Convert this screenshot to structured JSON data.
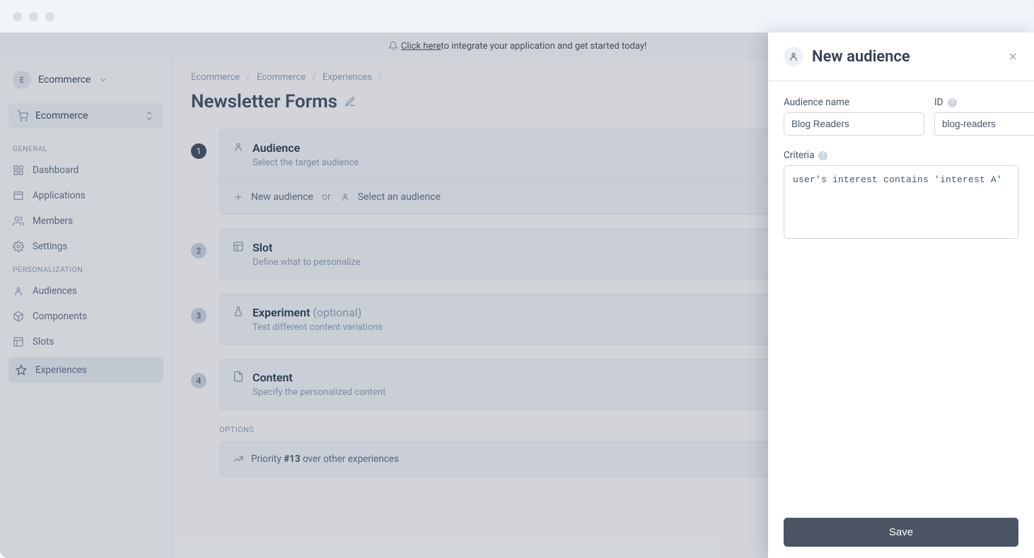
{
  "banner": {
    "link_text": "Click here",
    "rest": " to integrate your application and get started today!"
  },
  "workspace": {
    "name": "Ecommerce",
    "initial": "E"
  },
  "project": {
    "name": "Ecommerce"
  },
  "sidebar": {
    "section_general": "GENERAL",
    "section_personalization": "PERSONALIZATION",
    "items": {
      "dashboard": "Dashboard",
      "applications": "Applications",
      "members": "Members",
      "settings": "Settings",
      "audiences": "Audiences",
      "components": "Components",
      "slots": "Slots",
      "experiences": "Experiences"
    }
  },
  "breadcrumb": {
    "a": "Ecommerce",
    "b": "Ecommerce",
    "c": "Experiences"
  },
  "page": {
    "title": "Newsletter Forms"
  },
  "steps": {
    "audience": {
      "num": "1",
      "title": "Audience",
      "sub": "Select the target audience",
      "new_label": "New audience",
      "or": "or",
      "select_label": "Select an audience"
    },
    "slot": {
      "num": "2",
      "title": "Slot",
      "sub": "Define what to personalize"
    },
    "experiment": {
      "num": "3",
      "title_main": "Experiment ",
      "title_opt": "(optional)",
      "sub": "Test different content variations"
    },
    "content": {
      "num": "4",
      "title": "Content",
      "sub": "Specify the personalized content"
    }
  },
  "options": {
    "label": "OPTIONS",
    "priority_before": "Priority ",
    "priority_mid": "#13",
    "priority_after": " over other experiences"
  },
  "drawer": {
    "title": "New audience",
    "audience_name_label": "Audience name",
    "audience_name_value": "Blog Readers",
    "id_label": "ID",
    "id_value": "blog-readers",
    "criteria_label": "Criteria",
    "criteria_value": "user's interest contains 'interest A'",
    "save": "Save"
  }
}
